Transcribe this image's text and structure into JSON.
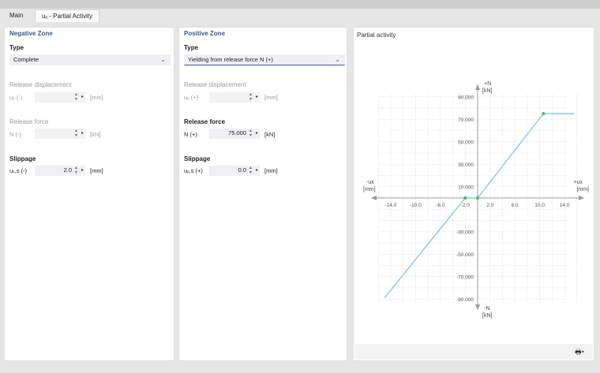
{
  "tabs": [
    {
      "label": "Main"
    },
    {
      "label": "uₓ - Partial Activity"
    }
  ],
  "negative_zone": {
    "title": "Negative Zone",
    "type_label": "Type",
    "type_value": "Complete",
    "release_displacement_label": "Release displacement",
    "release_displacement_field": "uₓ (-)",
    "release_displacement_unit": "[mm]",
    "release_force_label": "Release force",
    "release_force_field": "N (-)",
    "release_force_unit": "[kN]",
    "slippage_label": "Slippage",
    "slippage_field": "uₓ,s (-)",
    "slippage_value": "2.0",
    "slippage_unit": "[mm]"
  },
  "positive_zone": {
    "title": "Positive Zone",
    "type_label": "Type",
    "type_value": "Yielding from release force N (+)",
    "release_displacement_label": "Release displacement",
    "release_displacement_field": "uₓ (+)",
    "release_displacement_unit": "[mm]",
    "release_force_label": "Release force",
    "release_force_field": "N (+)",
    "release_force_value": "75.000",
    "release_force_unit": "[kN]",
    "slippage_label": "Slippage",
    "slippage_field": "uₓ,s (+)",
    "slippage_value": "0.0",
    "slippage_unit": "[mm]"
  },
  "chart_panel": {
    "title": "Partial activity",
    "print_icon": "printer-icon"
  },
  "chart_data": {
    "type": "line",
    "x_ticks": [
      -14.0,
      -10.0,
      -6.0,
      -2.0,
      2.0,
      6.0,
      10.0,
      14.0
    ],
    "y_ticks": [
      90000,
      70000,
      50000,
      30000,
      10000,
      -30000,
      -50000,
      -70000,
      -90000
    ],
    "x_tick_labels": [
      "-14.0",
      "-10.0",
      "-6.0",
      "-2.0",
      "2.0",
      "6.0",
      "10.0",
      "14.0"
    ],
    "y_tick_labels": [
      "90.000",
      "70.000",
      "50.000",
      "30.000",
      "10.000",
      "-30.000",
      "-50.000",
      "-70.000",
      "-90.000"
    ],
    "xlim": [
      -16,
      16
    ],
    "ylim": [
      -95000,
      100000
    ],
    "x_pos_label": "+ux",
    "x_neg_label": "-ux",
    "x_unit": "[mm]",
    "y_pos_label": "+N",
    "y_neg_label": "-N",
    "y_unit": "[kN]",
    "grid": true,
    "line_color": "#8fc3ea",
    "point_color": "#3cc83c",
    "series": [
      {
        "x": [
          -15.0,
          -2.0,
          0.0,
          10.6,
          15.6
        ],
        "y": [
          -89000,
          0,
          0,
          75000,
          75000
        ]
      }
    ],
    "markers": [
      {
        "x": -2.0,
        "y": 0
      },
      {
        "x": 0.0,
        "y": 0
      },
      {
        "x": 10.6,
        "y": 75000
      }
    ]
  }
}
